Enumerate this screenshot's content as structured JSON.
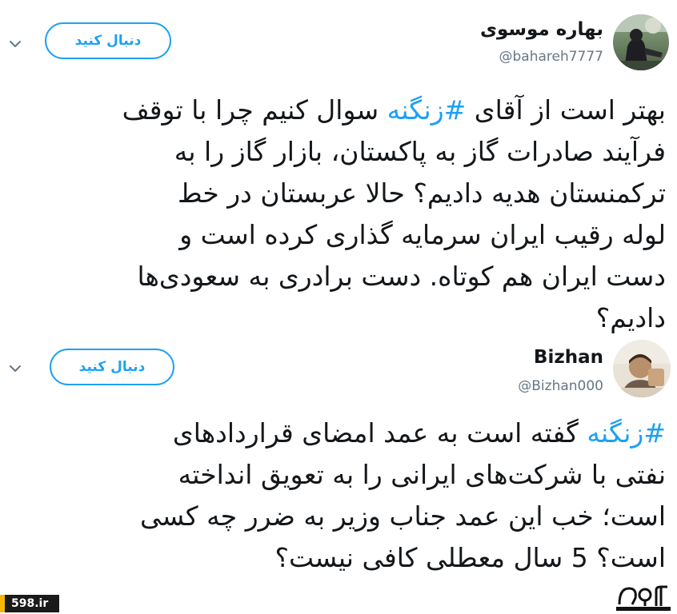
{
  "tweets": [
    {
      "display_name": "بهاره موسوی",
      "handle": "@bahareh7777",
      "follow_label": "دنبال کنید",
      "avatar": "avatar-photo-woman",
      "text_lines": [
        {
          "before": "بهتر است از آقای ",
          "hashtag": "#زنگنه",
          "after": " سوال کنیم چرا با توقف"
        },
        {
          "before": "فرآیند صادرات گاز به پاکستان، بازار گاز را به",
          "hashtag": "",
          "after": ""
        },
        {
          "before": "ترکمنستان هدیه دادیم؟ حالا عربستان در خط",
          "hashtag": "",
          "after": ""
        },
        {
          "before": "لوله رقیب ایران سرمایه گذاری کرده است و",
          "hashtag": "",
          "after": ""
        },
        {
          "before": "دست ایران هم کوتاه. دست برادری به سعودی‌ها",
          "hashtag": "",
          "after": ""
        },
        {
          "before": "دادیم؟",
          "hashtag": "",
          "after": ""
        }
      ]
    },
    {
      "display_name": "Bizhan",
      "handle": "@Bizhan000",
      "follow_label": "دنبال کنید",
      "avatar": "avatar-photo-man",
      "text_lines": [
        {
          "before": "",
          "hashtag": "#زنگنه",
          "after": " گفته است به عمد امضای قراردادهای"
        },
        {
          "before": "نفتی با شرکت‌های ایرانی را به تعویق انداخته",
          "hashtag": "",
          "after": ""
        },
        {
          "before": "است؛ خب این عمد جناب وزیر به ضرر چه کسی",
          "hashtag": "",
          "after": ""
        },
        {
          "before": "است؟ 5 سال معطلی کافی نیست؟",
          "hashtag": "",
          "after": ""
        }
      ]
    }
  ],
  "footer": {
    "site": "598.ir",
    "logo_text": "598"
  },
  "colors": {
    "accent": "#1da1f2",
    "text": "#14171a",
    "muted": "#657786"
  },
  "icons": {
    "menu": "chevron-down-icon"
  }
}
